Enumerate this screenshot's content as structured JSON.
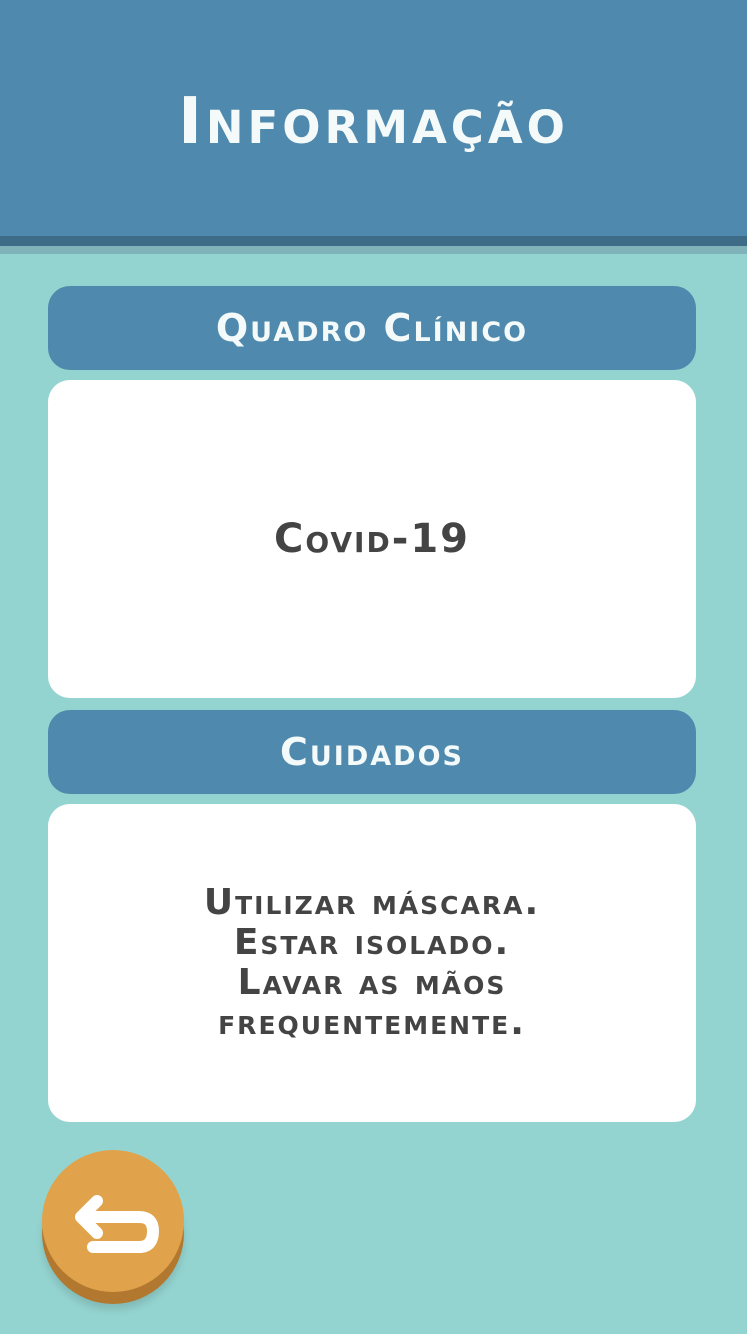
{
  "header": {
    "title": "Informação"
  },
  "sections": [
    {
      "title": "Quadro Clínico",
      "content": [
        "Covid-19"
      ]
    },
    {
      "title": "Cuidados",
      "content": [
        "Utilizar máscara.",
        "Estar isolado.",
        "Lavar as mãos",
        "frequentemente."
      ]
    }
  ],
  "back_button": {
    "icon": "back-arrow-icon"
  },
  "colors": {
    "background": "#94d4d0",
    "header": "#4f89ad",
    "card": "#ffffff",
    "button": "#e0a24a",
    "text_dark": "#444444",
    "text_light": "#f3faf9"
  }
}
